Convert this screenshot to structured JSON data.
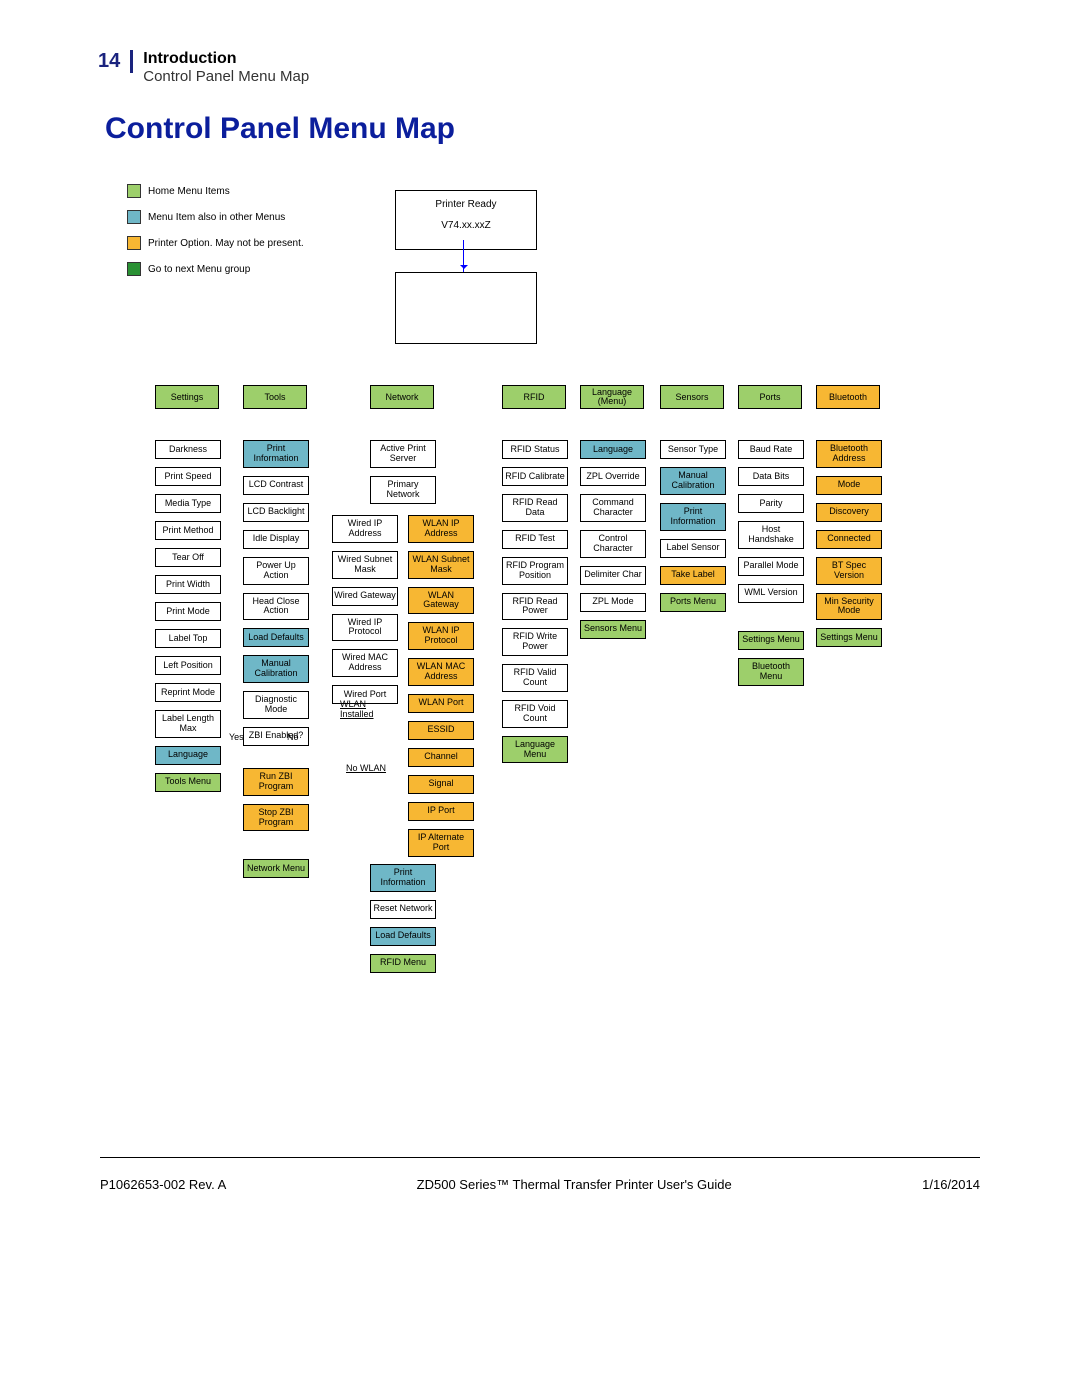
{
  "page": {
    "number": "14",
    "section": "Introduction",
    "subtitle": "Control Panel Menu Map"
  },
  "title": "Control Panel Menu Map",
  "legend": {
    "home": "Home Menu Items",
    "also": "Menu Item also in other Menus",
    "option": "Printer Option. May not be present.",
    "next": "Go to next Menu group"
  },
  "ready": {
    "status": "Printer Ready",
    "version": "V74.xx.xxZ"
  },
  "cats": {
    "settings": "Settings",
    "tools": "Tools",
    "network": "Network",
    "rfid": "RFID",
    "language": "Language (Menu)",
    "sensors": "Sensors",
    "ports": "Ports",
    "bluetooth": "Bluetooth"
  },
  "settings": [
    "Darkness",
    "Print Speed",
    "Media Type",
    "Print Method",
    "Tear Off",
    "Print Width",
    "Print Mode",
    "Label Top",
    "Left Position",
    "Reprint Mode",
    "Label Length Max"
  ],
  "settings_end": {
    "lang": "Language",
    "tools_menu": "Tools Menu"
  },
  "tools": {
    "print_info": "Print Information",
    "items": [
      "LCD Contrast",
      "LCD Backlight",
      "Idle Display",
      "Power Up Action",
      "Head Close Action"
    ],
    "load_def": "Load Defaults",
    "man_cal": "Manual Calibration",
    "diag": "Diagnostic Mode",
    "zbi_en": "ZBI Enabled?",
    "run_zbi": "Run ZBI Program",
    "stop_zbi": "Stop ZBI Program",
    "net_menu": "Network Menu",
    "yes": "Yes",
    "no": "No"
  },
  "network": {
    "aps": "Active Print Server",
    "prim": "Primary Network",
    "wired": [
      "Wired IP Address",
      "Wired Subnet Mask",
      "Wired Gateway",
      "Wired IP Protocol",
      "Wired MAC Address",
      "Wired Port"
    ],
    "wlan": [
      "WLAN IP Address",
      "WLAN Subnet Mask",
      "WLAN Gateway",
      "WLAN IP Protocol",
      "WLAN MAC Address",
      "WLAN Port",
      "ESSID",
      "Channel",
      "Signal",
      "IP Port",
      "IP Alternate Port"
    ],
    "print_info": "Print Information",
    "reset": "Reset Network",
    "load_def": "Load Defaults",
    "rfid_menu": "RFID Menu",
    "wlan_inst": "WLAN Installed",
    "no_wlan": "No WLAN"
  },
  "rfid": [
    "RFID Status",
    "RFID Calibrate",
    "RFID Read Data",
    "RFID Test",
    "RFID Program Position",
    "RFID Read Power",
    "RFID Write Power",
    "RFID Valid Count",
    "RFID Void Count"
  ],
  "rfid_end": "Language Menu",
  "language": {
    "lang": "Language",
    "items": [
      "ZPL Override",
      "Command Character",
      "Control Character",
      "Delimiter Char",
      "ZPL Mode"
    ],
    "sens_menu": "Sensors Menu"
  },
  "sensors": {
    "type": "Sensor Type",
    "man_cal": "Manual Calibration",
    "print_info": "Print Information",
    "label": "Label Sensor",
    "take": "Take Label",
    "ports_menu": "Ports Menu"
  },
  "ports": {
    "items": [
      "Baud Rate",
      "Data Bits",
      "Parity",
      "Host Handshake",
      "Parallel Mode",
      "WML Version"
    ],
    "set_menu": "Settings Menu",
    "bt_menu": "Bluetooth Menu"
  },
  "bluetooth": {
    "addr": "Bluetooth Address",
    "items": [
      "Mode",
      "Discovery",
      "Connected",
      "BT Spec Version",
      "Min Security Mode"
    ],
    "set_menu": "Settings Menu"
  },
  "footer": {
    "left": "P1062653-002 Rev. A",
    "center": "ZD500 Series™ Thermal Transfer Printer User's Guide",
    "right": "1/16/2014"
  }
}
